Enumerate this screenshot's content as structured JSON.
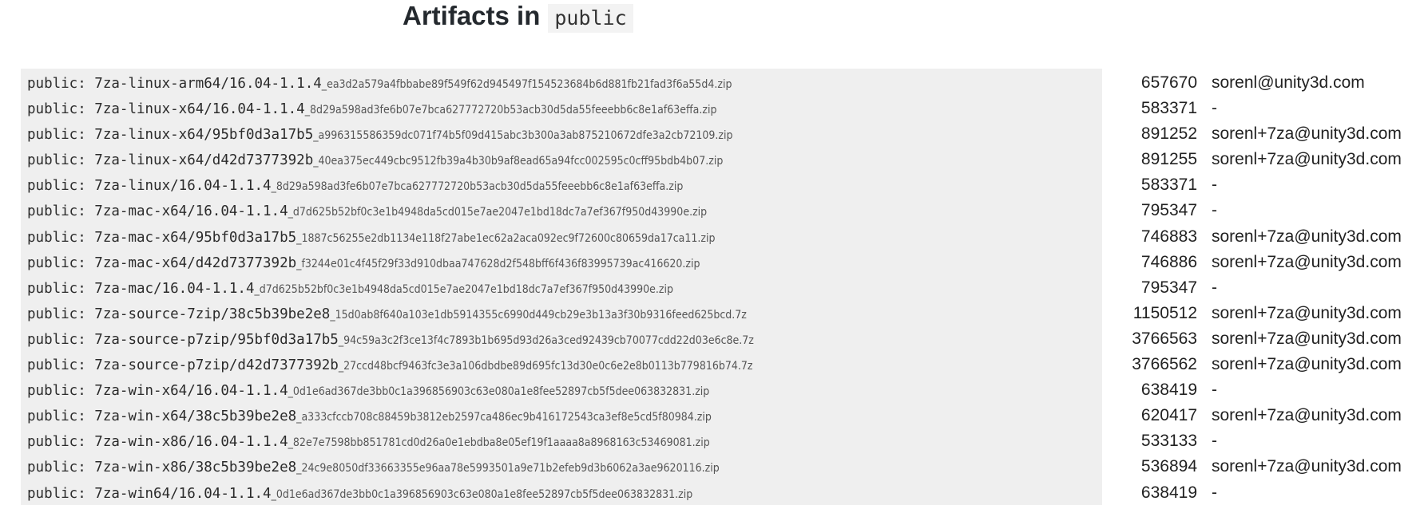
{
  "heading": {
    "text": "Artifacts in",
    "code": "public"
  },
  "artifacts": [
    {
      "prefix": "public: ",
      "name": "7za-linux-arm64/16.04-1.1.4",
      "hash": "_ea3d2a579a4fbbabe89f549f62d945497f154523684b6d881fb21fad3f6a55d4.zip",
      "size": "657670",
      "uploader": "sorenl@unity3d.com"
    },
    {
      "prefix": "public: ",
      "name": "7za-linux-x64/16.04-1.1.4",
      "hash": "_8d29a598ad3fe6b07e7bca627772720b53acb30d5da55feeebb6c8e1af63effa.zip",
      "size": "583371",
      "uploader": "-"
    },
    {
      "prefix": "public: ",
      "name": "7za-linux-x64/95bf0d3a17b5",
      "hash": "_a996315586359dc071f74b5f09d415abc3b300a3ab875210672dfe3a2cb72109.zip",
      "size": "891252",
      "uploader": "sorenl+7za@unity3d.com"
    },
    {
      "prefix": "public: ",
      "name": "7za-linux-x64/d42d7377392b",
      "hash": "_40ea375ec449cbc9512fb39a4b30b9af8ead65a94fcc002595c0cff95bdb4b07.zip",
      "size": "891255",
      "uploader": "sorenl+7za@unity3d.com"
    },
    {
      "prefix": "public: ",
      "name": "7za-linux/16.04-1.1.4",
      "hash": "_8d29a598ad3fe6b07e7bca627772720b53acb30d5da55feeebb6c8e1af63effa.zip",
      "size": "583371",
      "uploader": "-"
    },
    {
      "prefix": "public: ",
      "name": "7za-mac-x64/16.04-1.1.4",
      "hash": "_d7d625b52bf0c3e1b4948da5cd015e7ae2047e1bd18dc7a7ef367f950d43990e.zip",
      "size": "795347",
      "uploader": "-"
    },
    {
      "prefix": "public: ",
      "name": "7za-mac-x64/95bf0d3a17b5",
      "hash": "_1887c56255e2db1134e118f27abe1ec62a2aca092ec9f72600c80659da17ca11.zip",
      "size": "746883",
      "uploader": "sorenl+7za@unity3d.com"
    },
    {
      "prefix": "public: ",
      "name": "7za-mac-x64/d42d7377392b",
      "hash": "_f3244e01c4f45f29f33d910dbaa747628d2f548bff6f436f83995739ac416620.zip",
      "size": "746886",
      "uploader": "sorenl+7za@unity3d.com"
    },
    {
      "prefix": "public: ",
      "name": "7za-mac/16.04-1.1.4",
      "hash": "_d7d625b52bf0c3e1b4948da5cd015e7ae2047e1bd18dc7a7ef367f950d43990e.zip",
      "size": "795347",
      "uploader": "-"
    },
    {
      "prefix": "public: ",
      "name": "7za-source-7zip/38c5b39be2e8",
      "hash": "_15d0ab8f640a103e1db5914355c6990d449cb29e3b13a3f30b9316feed625bcd.7z",
      "size": "1150512",
      "uploader": "sorenl+7za@unity3d.com"
    },
    {
      "prefix": "public: ",
      "name": "7za-source-p7zip/95bf0d3a17b5",
      "hash": "_94c59a3c2f3ce13f4c7893b1b695d93d26a3ced92439cb70077cdd22d03e6c8e.7z",
      "size": "3766563",
      "uploader": "sorenl+7za@unity3d.com"
    },
    {
      "prefix": "public: ",
      "name": "7za-source-p7zip/d42d7377392b",
      "hash": "_27ccd48bcf9463fc3e3a106dbdbe89d695fc13d30e0c6e2e8b0113b779816b74.7z",
      "size": "3766562",
      "uploader": "sorenl+7za@unity3d.com"
    },
    {
      "prefix": "public: ",
      "name": "7za-win-x64/16.04-1.1.4",
      "hash": "_0d1e6ad367de3bb0c1a396856903c63e080a1e8fee52897cb5f5dee063832831.zip",
      "size": "638419",
      "uploader": "-"
    },
    {
      "prefix": "public: ",
      "name": "7za-win-x64/38c5b39be2e8",
      "hash": "_a333cfccb708c88459b3812eb2597ca486ec9b416172543ca3ef8e5cd5f80984.zip",
      "size": "620417",
      "uploader": "sorenl+7za@unity3d.com"
    },
    {
      "prefix": "public: ",
      "name": "7za-win-x86/16.04-1.1.4",
      "hash": "_82e7e7598bb851781cd0d26a0e1ebdba8e05ef19f1aaaa8a8968163c53469081.zip",
      "size": "533133",
      "uploader": "-"
    },
    {
      "prefix": "public: ",
      "name": "7za-win-x86/38c5b39be2e8",
      "hash": "_24c9e8050df33663355e96aa78e5993501a9e71b2efeb9d3b6062a3ae9620116.zip",
      "size": "536894",
      "uploader": "sorenl+7za@unity3d.com"
    },
    {
      "prefix": "public: ",
      "name": "7za-win64/16.04-1.1.4",
      "hash": "_0d1e6ad367de3bb0c1a396856903c63e080a1e8fee52897cb5f5dee063832831.zip",
      "size": "638419",
      "uploader": "-"
    }
  ]
}
